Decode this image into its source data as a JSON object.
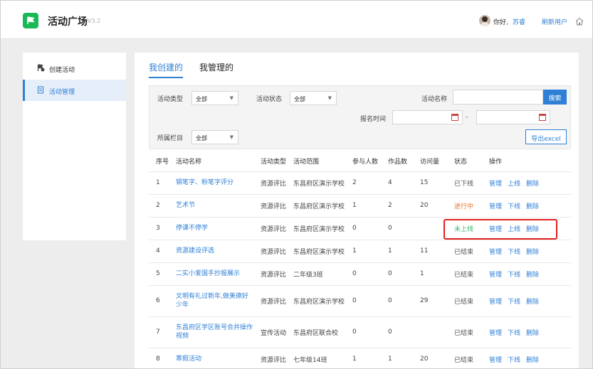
{
  "header": {
    "app_title": "活动广场",
    "version": "V3.2",
    "greeting": "你好,",
    "username": "苏睿",
    "refresh_label": "刷新用户",
    "brand_color": "#19b955",
    "accent_color": "#2f7fd6"
  },
  "sidebar": {
    "items": [
      {
        "label": "创建活动",
        "icon": "create-activity-icon",
        "active": false
      },
      {
        "label": "活动管理",
        "icon": "manage-activity-icon",
        "active": true
      }
    ]
  },
  "tabs": [
    {
      "label": "我创建的",
      "active": true
    },
    {
      "label": "我管理的",
      "active": false
    }
  ],
  "filters": {
    "type_label": "活动类型",
    "type_value": "全部",
    "status_label": "活动状态",
    "status_value": "全部",
    "name_label": "活动名称",
    "name_value": "",
    "search_label": "搜索",
    "time_label": "报名时间",
    "time_separator": "-",
    "start_value": "",
    "end_value": "",
    "column_label": "所属栏目",
    "column_value": "全部",
    "export_label": "导出excel"
  },
  "table": {
    "headers": [
      "序号",
      "活动名称",
      "活动类型",
      "活动范围",
      "参与人数",
      "作品数",
      "访问量",
      "状态",
      "操作"
    ],
    "rows": [
      {
        "no": "1",
        "name": "钢笔字、粉笔字评分",
        "type": "资源评比",
        "scope": "东昌府区演示学校",
        "participants": "2",
        "works": "4",
        "visits": "15",
        "status": "已下线",
        "status_kind": "off",
        "ops": [
          "管理",
          "上线",
          "删除"
        ]
      },
      {
        "no": "2",
        "name": "艺术节",
        "type": "资源评比",
        "scope": "东昌府区演示学校",
        "participants": "1",
        "works": "2",
        "visits": "20",
        "status": "进行中",
        "status_kind": "on",
        "ops": [
          "管理",
          "下线",
          "删除"
        ]
      },
      {
        "no": "3",
        "name": "停课不停学",
        "type": "资源评比",
        "scope": "东昌府区演示学校",
        "participants": "0",
        "works": "0",
        "visits": "",
        "status": "未上线",
        "status_kind": "not",
        "ops": [
          "管理",
          "上线",
          "删除"
        ]
      },
      {
        "no": "4",
        "name": "资源建设评选",
        "type": "资源评比",
        "scope": "东昌府区演示学校",
        "participants": "1",
        "works": "1",
        "visits": "11",
        "status": "已结束",
        "status_kind": "end",
        "ops": [
          "管理",
          "下线",
          "删除"
        ]
      },
      {
        "no": "5",
        "name": "二实小爱国手抄报展示",
        "type": "资源评比",
        "scope": "二年级3班",
        "participants": "0",
        "works": "0",
        "visits": "1",
        "status": "已结束",
        "status_kind": "end",
        "ops": [
          "管理",
          "下线",
          "删除"
        ]
      },
      {
        "no": "6",
        "name": "文明有礼过新年,做美德好少年",
        "type": "资源评比",
        "scope": "东昌府区演示学校",
        "participants": "0",
        "works": "0",
        "visits": "29",
        "status": "已结束",
        "status_kind": "end",
        "ops": [
          "管理",
          "下线",
          "删除"
        ]
      },
      {
        "no": "7",
        "name": "东昌府区学区账号合并操作视频",
        "type": "宣传活动",
        "scope": "东昌府区联合校",
        "participants": "0",
        "works": "0",
        "visits": "",
        "status": "已结束",
        "status_kind": "end",
        "ops": [
          "管理",
          "下线",
          "删除"
        ]
      },
      {
        "no": "8",
        "name": "寒假活动",
        "type": "资源评比",
        "scope": "七年级14班",
        "participants": "1",
        "works": "1",
        "visits": "20",
        "status": "已结束",
        "status_kind": "end",
        "ops": [
          "管理",
          "下线",
          "删除"
        ]
      }
    ]
  }
}
